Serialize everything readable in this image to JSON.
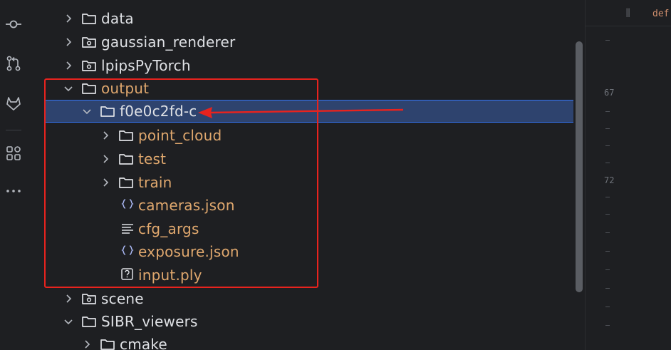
{
  "tree": {
    "items": [
      {
        "label": "data",
        "type": "folder",
        "expanded": false,
        "depth": 0,
        "icon": "folder-icon",
        "color": "#dfe1e5"
      },
      {
        "label": "gaussian_renderer",
        "type": "package",
        "expanded": false,
        "depth": 0,
        "icon": "package-folder-icon",
        "color": "#dfe1e5"
      },
      {
        "label": "lpipsPyTorch",
        "type": "package",
        "expanded": false,
        "depth": 0,
        "icon": "package-folder-icon",
        "color": "#dfe1e5"
      },
      {
        "label": "output",
        "type": "folder",
        "expanded": true,
        "depth": 0,
        "icon": "folder-icon",
        "color": "#e0a86e"
      },
      {
        "label": "f0e0c2fd-c",
        "type": "folder",
        "expanded": true,
        "depth": 1,
        "icon": "folder-icon",
        "selected": true,
        "color": "#dfe1e5"
      },
      {
        "label": "point_cloud",
        "type": "folder",
        "expanded": false,
        "depth": 2,
        "icon": "folder-icon",
        "color": "#e0a86e"
      },
      {
        "label": "test",
        "type": "folder",
        "expanded": false,
        "depth": 2,
        "icon": "folder-icon",
        "color": "#e0a86e"
      },
      {
        "label": "train",
        "type": "folder",
        "expanded": false,
        "depth": 2,
        "icon": "folder-icon",
        "color": "#e0a86e"
      },
      {
        "label": "cameras.json",
        "type": "file",
        "depth": 2,
        "icon": "json-braces-icon",
        "color": "#e0a86e"
      },
      {
        "label": "cfg_args",
        "type": "file",
        "depth": 2,
        "icon": "text-lines-icon",
        "color": "#e0a86e"
      },
      {
        "label": "exposure.json",
        "type": "file",
        "depth": 2,
        "icon": "json-braces-icon",
        "color": "#e0a86e"
      },
      {
        "label": "input.ply",
        "type": "file",
        "depth": 2,
        "icon": "unknown-file-icon",
        "color": "#e0a86e"
      },
      {
        "label": "scene",
        "type": "package",
        "expanded": false,
        "depth": 0,
        "icon": "package-folder-icon",
        "color": "#dfe1e5"
      },
      {
        "label": "SIBR_viewers",
        "type": "folder",
        "expanded": true,
        "depth": 0,
        "icon": "folder-icon",
        "color": "#dfe1e5"
      },
      {
        "label": "cmake",
        "type": "folder",
        "expanded": false,
        "depth": 1,
        "icon": "folder-icon",
        "color": "#dfe1e5"
      }
    ]
  },
  "activity_bar": {
    "icons": [
      "commit-icon",
      "pull-request-icon",
      "gitlab-icon",
      "plugins-icon",
      "more-icon"
    ]
  },
  "editor": {
    "keyword_fragment": "def",
    "gutter": [
      "67",
      "72"
    ]
  },
  "colors": {
    "background": "#1e1f22",
    "selection": "#2e436e",
    "excluded_orange": "#e0a86e",
    "highlight_red": "#e8231e"
  }
}
